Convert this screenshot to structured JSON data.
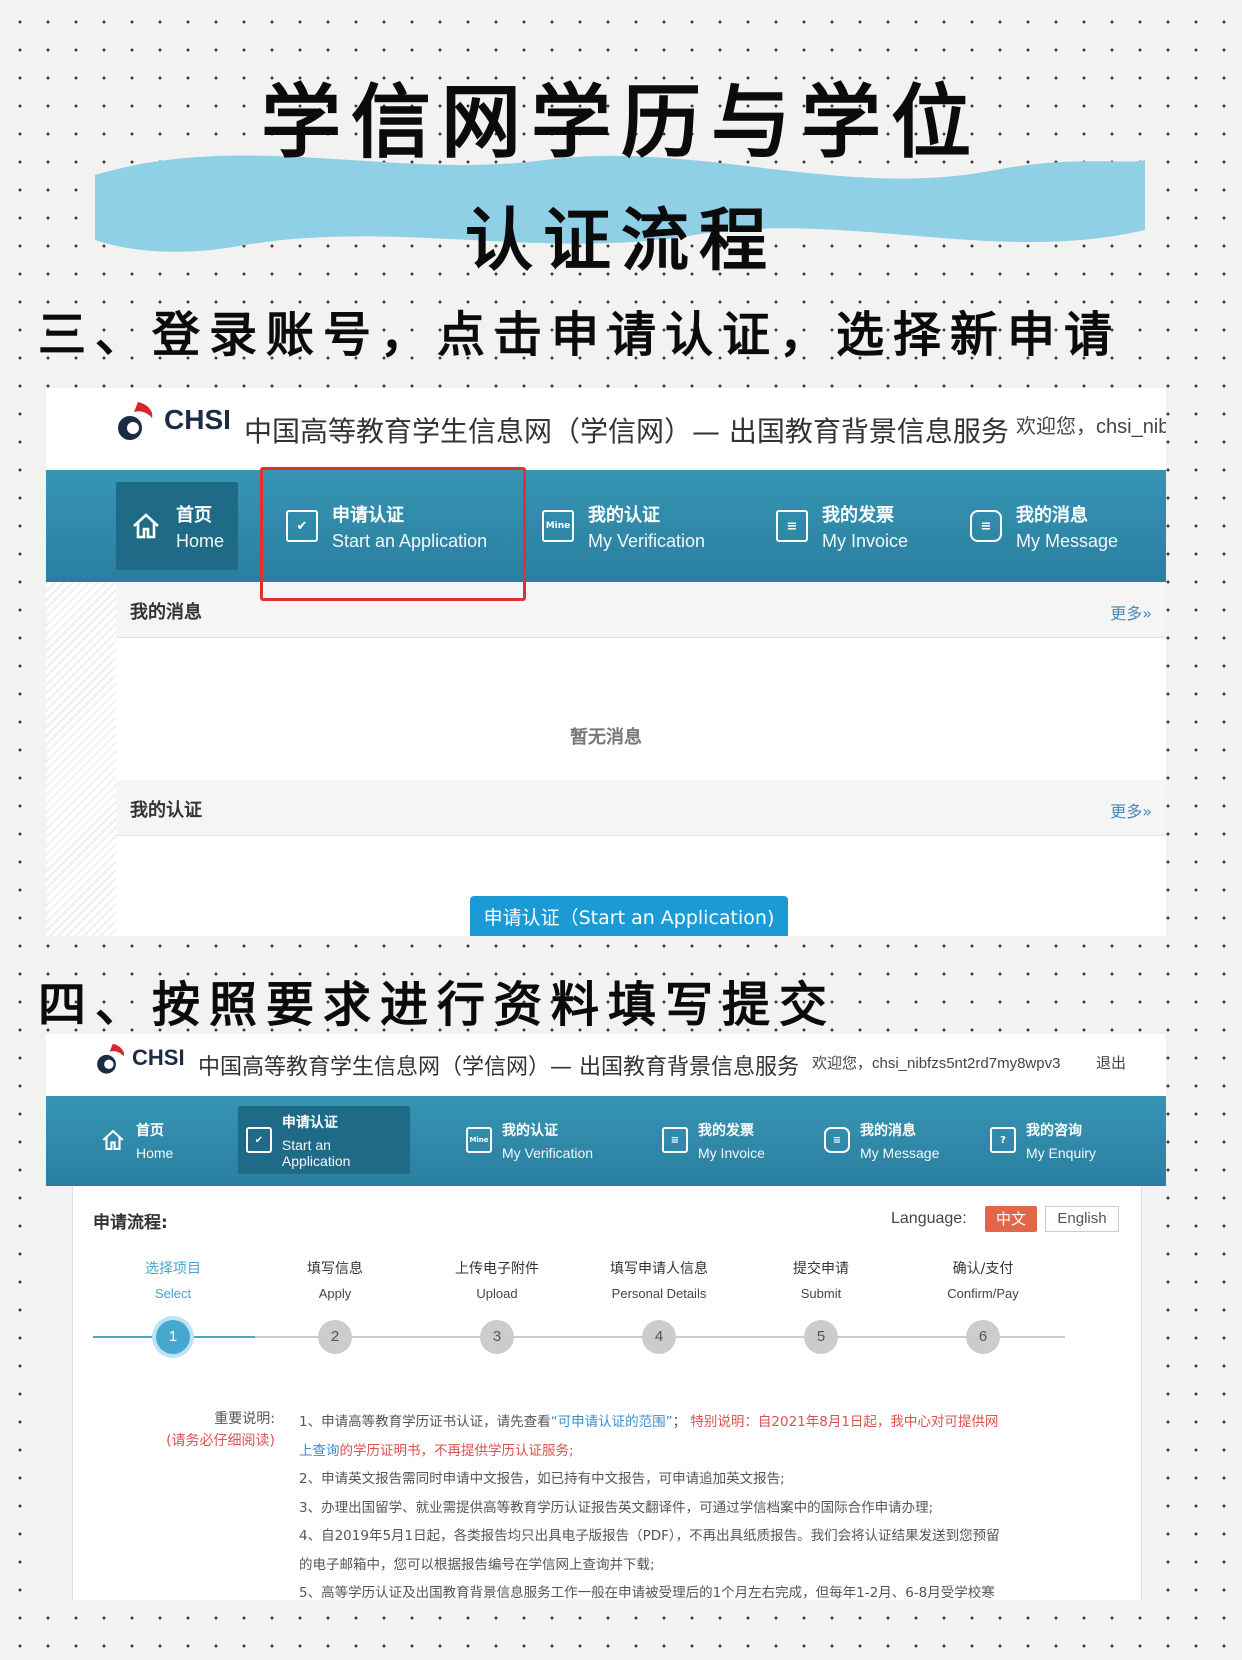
{
  "headline": {
    "title_line1": "学信网学历与学位",
    "title_line2": "认证流程",
    "step3": "三、登录账号，点击申请认证，选择新申请",
    "step4": "四、按照要求进行资料填写提交"
  },
  "colors": {
    "accent_blue": "#2a89ad",
    "highlight_red": "#e0312f",
    "wave": "#8fd0e6",
    "active_step": "#45a9cf",
    "lang_active": "#e2674a"
  },
  "screenshot1": {
    "logo_text": "CHSI",
    "site_name": "中国高等教育学生信息网（学信网）— 出国教育背景信息服务",
    "welcome": "欢迎您，chsi_nib",
    "nav": [
      {
        "zh": "首页",
        "en": "Home",
        "icon": "home-icon"
      },
      {
        "zh": "申请认证",
        "en": "Start an Application",
        "icon": "checkbox-icon"
      },
      {
        "zh": "我的认证",
        "en": "My Verification",
        "icon": "mine-icon"
      },
      {
        "zh": "我的发票",
        "en": "My Invoice",
        "icon": "invoice-icon"
      },
      {
        "zh": "我的消息",
        "en": "My Message",
        "icon": "message-icon"
      }
    ],
    "messages_title": "我的消息",
    "more": "更多»",
    "no_messages": "暂无消息",
    "verification_title": "我的认证",
    "apply_button": "申请认证（Start an Application)"
  },
  "screenshot2": {
    "logo_text": "CHSI",
    "site_name": "中国高等教育学生信息网（学信网）— 出国教育背景信息服务",
    "welcome": "欢迎您，chsi_nibfzs5nt2rd7my8wpv3",
    "logout": "退出",
    "nav": [
      {
        "zh": "首页",
        "en": "Home",
        "icon": "home-icon"
      },
      {
        "zh": "申请认证",
        "en": "Start an Application",
        "icon": "checkbox-icon"
      },
      {
        "zh": "我的认证",
        "en": "My Verification",
        "icon": "mine-icon"
      },
      {
        "zh": "我的发票",
        "en": "My Invoice",
        "icon": "invoice-icon"
      },
      {
        "zh": "我的消息",
        "en": "My Message",
        "icon": "message-icon"
      },
      {
        "zh": "我的咨询",
        "en": "My Enquiry",
        "icon": "enquiry-icon"
      }
    ],
    "flow_label": "申请流程:",
    "language_label": "Language:",
    "lang_zh": "中文",
    "lang_en": "English",
    "steps": [
      {
        "zh": "选择项目",
        "en": "Select",
        "num": "1"
      },
      {
        "zh": "填写信息",
        "en": "Apply",
        "num": "2"
      },
      {
        "zh": "上传电子附件",
        "en": "Upload",
        "num": "3"
      },
      {
        "zh": "填写申请人信息",
        "en": "Personal Details",
        "num": "4"
      },
      {
        "zh": "提交申请",
        "en": "Submit",
        "num": "5"
      },
      {
        "zh": "确认/支付",
        "en": "Confirm/Pay",
        "num": "6"
      }
    ],
    "notes_label": "重要说明:",
    "notes_label_em": "(请务必仔细阅读)",
    "notes": {
      "n1_a": "1、申请高等教育学历证书认证，请先查看",
      "n1_link": "“可申请认证的范围”",
      "n1_b": "；",
      "n1_c": "特别说明：自2021年8月1日起，我中心对可提供网",
      "n1_d": "上查询",
      "n1_e": "的学历证明书，不再提供学历认证服务;",
      "n2": "2、申请英文报告需同时申请中文报告，如已持有中文报告，可申请追加英文报告;",
      "n3": "3、办理出国留学、就业需提供高等教育学历认证报告英文翻译件，可通过学信档案中的国际合作申请办理;",
      "n4": "4、自2019年5月1日起，各类报告均只出具电子版报告（PDF），不再出具纸质报告。我们会将认证结果发送到您预留",
      "n4_b": "的电子邮箱中，您可以根据报告编号在学信网上查询并下载;",
      "n5": "5、高等学历认证及出国教育背景信息服务工作一般在申请被受理后的1个月左右完成，但每年1-2月、6-8月受学校寒"
    }
  }
}
